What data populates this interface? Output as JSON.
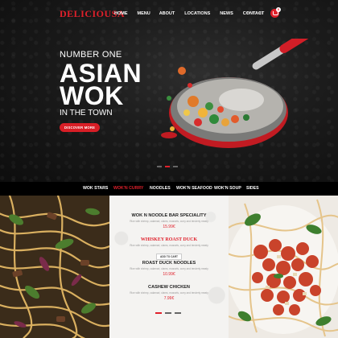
{
  "brand": {
    "logo": "DELICIOUSA",
    "accent": "#e0202b"
  },
  "nav": {
    "links": [
      "HOME",
      "MENU",
      "ABOUT",
      "LOCATIONS",
      "NEWS",
      "CONTACT"
    ],
    "social": [
      "f",
      "t",
      "in"
    ],
    "cart_count": "0"
  },
  "hero": {
    "kicker": "NUMBER ONE",
    "title_line1": "ASIAN",
    "title_line2": "WOK",
    "subtitle": "IN THE TOWN",
    "cta": "DISCOVER MORE",
    "slides": 3,
    "active_slide": 1
  },
  "tabs": {
    "items": [
      "WOK STARS",
      "WOK'N CURRY",
      "NOODLES",
      "WOK'N SEAFOOD",
      "WOK'N SOUP",
      "SIDES"
    ],
    "active": 1
  },
  "menu": {
    "items": [
      {
        "name": "WOK N NOODLE BAR SPECIALITY",
        "desc": "Rice with shrimp, calamari, clams, mussels, curry and tenderly meaty",
        "price": "15.99€",
        "style": "dark"
      },
      {
        "name": "WHISKEY ROAST DUCK",
        "desc": "Rice with shrimp, calamari, clams, mussels, curry and tenderly meaty",
        "price": "",
        "style": "red",
        "button": "ADD TO CART"
      },
      {
        "name": "ROAST DUCK NOODLES",
        "desc": "Rice with shrimp, calamari, clams, mussels, curry and tenderly meaty",
        "price": "10.99€",
        "style": "dark"
      },
      {
        "name": "CASHEW CHICKEN",
        "desc": "Rice with shrimp, calamari, clams, mussels, curry and tenderly meaty",
        "price": "7.99€",
        "style": "dark"
      }
    ],
    "pages": 3,
    "active_page": 0
  }
}
